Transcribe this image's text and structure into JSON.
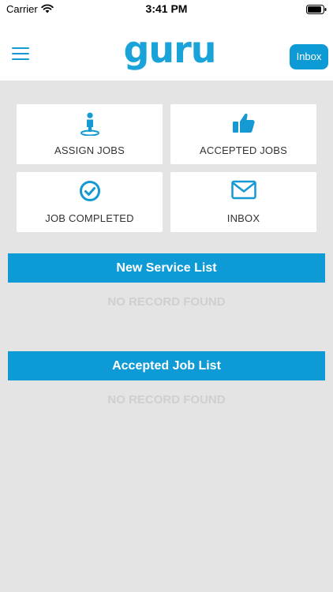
{
  "status_bar": {
    "carrier": "Carrier",
    "time": "3:41 PM"
  },
  "header": {
    "logo_text": "guru",
    "inbox_button": "Inbox"
  },
  "tiles": [
    {
      "label": "ASSIGN JOBS",
      "icon": "person-pin-icon"
    },
    {
      "label": "ACCEPTED JOBS",
      "icon": "thumbs-up-icon"
    },
    {
      "label": "JOB COMPLETED",
      "icon": "check-circle-icon"
    },
    {
      "label": "INBOX",
      "icon": "envelope-icon"
    }
  ],
  "sections": [
    {
      "title": "New Service List",
      "empty_text": "NO RECORD FOUND"
    },
    {
      "title": "Accepted Job List",
      "empty_text": "NO RECORD FOUND"
    }
  ],
  "colors": {
    "accent": "#0e9ad4",
    "background": "#e4e4e4",
    "empty_text": "#cfcfcf"
  }
}
